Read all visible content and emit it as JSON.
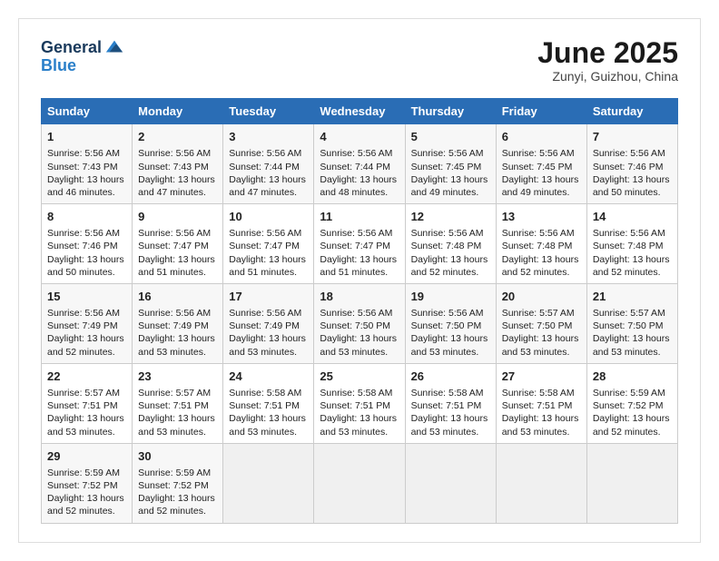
{
  "logo": {
    "general": "General",
    "blue": "Blue"
  },
  "title": "June 2025",
  "subtitle": "Zunyi, Guizhou, China",
  "headers": [
    "Sunday",
    "Monday",
    "Tuesday",
    "Wednesday",
    "Thursday",
    "Friday",
    "Saturday"
  ],
  "weeks": [
    [
      {
        "day": "1",
        "info": "Sunrise: 5:56 AM\nSunset: 7:43 PM\nDaylight: 13 hours\nand 46 minutes."
      },
      {
        "day": "2",
        "info": "Sunrise: 5:56 AM\nSunset: 7:43 PM\nDaylight: 13 hours\nand 47 minutes."
      },
      {
        "day": "3",
        "info": "Sunrise: 5:56 AM\nSunset: 7:44 PM\nDaylight: 13 hours\nand 47 minutes."
      },
      {
        "day": "4",
        "info": "Sunrise: 5:56 AM\nSunset: 7:44 PM\nDaylight: 13 hours\nand 48 minutes."
      },
      {
        "day": "5",
        "info": "Sunrise: 5:56 AM\nSunset: 7:45 PM\nDaylight: 13 hours\nand 49 minutes."
      },
      {
        "day": "6",
        "info": "Sunrise: 5:56 AM\nSunset: 7:45 PM\nDaylight: 13 hours\nand 49 minutes."
      },
      {
        "day": "7",
        "info": "Sunrise: 5:56 AM\nSunset: 7:46 PM\nDaylight: 13 hours\nand 50 minutes."
      }
    ],
    [
      {
        "day": "8",
        "info": "Sunrise: 5:56 AM\nSunset: 7:46 PM\nDaylight: 13 hours\nand 50 minutes."
      },
      {
        "day": "9",
        "info": "Sunrise: 5:56 AM\nSunset: 7:47 PM\nDaylight: 13 hours\nand 51 minutes."
      },
      {
        "day": "10",
        "info": "Sunrise: 5:56 AM\nSunset: 7:47 PM\nDaylight: 13 hours\nand 51 minutes."
      },
      {
        "day": "11",
        "info": "Sunrise: 5:56 AM\nSunset: 7:47 PM\nDaylight: 13 hours\nand 51 minutes."
      },
      {
        "day": "12",
        "info": "Sunrise: 5:56 AM\nSunset: 7:48 PM\nDaylight: 13 hours\nand 52 minutes."
      },
      {
        "day": "13",
        "info": "Sunrise: 5:56 AM\nSunset: 7:48 PM\nDaylight: 13 hours\nand 52 minutes."
      },
      {
        "day": "14",
        "info": "Sunrise: 5:56 AM\nSunset: 7:48 PM\nDaylight: 13 hours\nand 52 minutes."
      }
    ],
    [
      {
        "day": "15",
        "info": "Sunrise: 5:56 AM\nSunset: 7:49 PM\nDaylight: 13 hours\nand 52 minutes."
      },
      {
        "day": "16",
        "info": "Sunrise: 5:56 AM\nSunset: 7:49 PM\nDaylight: 13 hours\nand 53 minutes."
      },
      {
        "day": "17",
        "info": "Sunrise: 5:56 AM\nSunset: 7:49 PM\nDaylight: 13 hours\nand 53 minutes."
      },
      {
        "day": "18",
        "info": "Sunrise: 5:56 AM\nSunset: 7:50 PM\nDaylight: 13 hours\nand 53 minutes."
      },
      {
        "day": "19",
        "info": "Sunrise: 5:56 AM\nSunset: 7:50 PM\nDaylight: 13 hours\nand 53 minutes."
      },
      {
        "day": "20",
        "info": "Sunrise: 5:57 AM\nSunset: 7:50 PM\nDaylight: 13 hours\nand 53 minutes."
      },
      {
        "day": "21",
        "info": "Sunrise: 5:57 AM\nSunset: 7:50 PM\nDaylight: 13 hours\nand 53 minutes."
      }
    ],
    [
      {
        "day": "22",
        "info": "Sunrise: 5:57 AM\nSunset: 7:51 PM\nDaylight: 13 hours\nand 53 minutes."
      },
      {
        "day": "23",
        "info": "Sunrise: 5:57 AM\nSunset: 7:51 PM\nDaylight: 13 hours\nand 53 minutes."
      },
      {
        "day": "24",
        "info": "Sunrise: 5:58 AM\nSunset: 7:51 PM\nDaylight: 13 hours\nand 53 minutes."
      },
      {
        "day": "25",
        "info": "Sunrise: 5:58 AM\nSunset: 7:51 PM\nDaylight: 13 hours\nand 53 minutes."
      },
      {
        "day": "26",
        "info": "Sunrise: 5:58 AM\nSunset: 7:51 PM\nDaylight: 13 hours\nand 53 minutes."
      },
      {
        "day": "27",
        "info": "Sunrise: 5:58 AM\nSunset: 7:51 PM\nDaylight: 13 hours\nand 53 minutes."
      },
      {
        "day": "28",
        "info": "Sunrise: 5:59 AM\nSunset: 7:52 PM\nDaylight: 13 hours\nand 52 minutes."
      }
    ],
    [
      {
        "day": "29",
        "info": "Sunrise: 5:59 AM\nSunset: 7:52 PM\nDaylight: 13 hours\nand 52 minutes."
      },
      {
        "day": "30",
        "info": "Sunrise: 5:59 AM\nSunset: 7:52 PM\nDaylight: 13 hours\nand 52 minutes."
      },
      {
        "day": "",
        "info": ""
      },
      {
        "day": "",
        "info": ""
      },
      {
        "day": "",
        "info": ""
      },
      {
        "day": "",
        "info": ""
      },
      {
        "day": "",
        "info": ""
      }
    ]
  ]
}
